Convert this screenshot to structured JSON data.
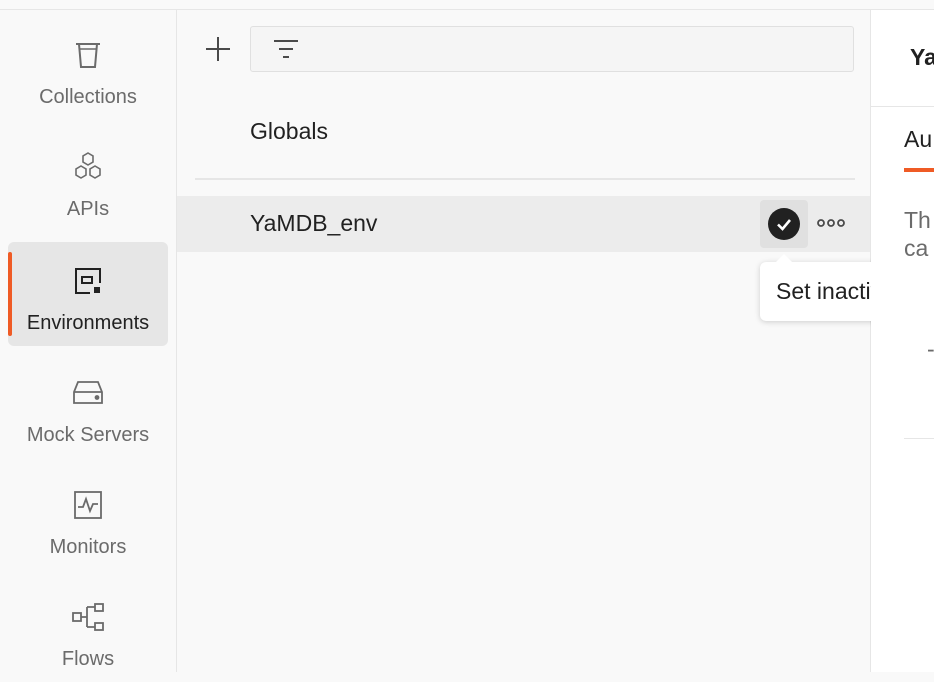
{
  "sidebar": {
    "items": [
      {
        "label": "Collections",
        "icon": "trash-can-icon"
      },
      {
        "label": "APIs",
        "icon": "hexagons-icon"
      },
      {
        "label": "Environments",
        "icon": "environment-icon",
        "active": true
      },
      {
        "label": "Mock Servers",
        "icon": "server-icon"
      },
      {
        "label": "Monitors",
        "icon": "monitor-pulse-icon"
      },
      {
        "label": "Flows",
        "icon": "flows-icon"
      }
    ]
  },
  "list": {
    "filter_placeholder": "",
    "globals_label": "Globals",
    "environments": [
      {
        "name": "YaMDB_env",
        "active": true
      }
    ]
  },
  "tooltip": {
    "text": "Set inactive"
  },
  "right_panel": {
    "title": "Ya",
    "tab": "Au",
    "text_line1": "Th",
    "text_line2": "ca",
    "mark": "-"
  },
  "colors": {
    "accent": "#ef5b25",
    "background": "#f9f9f9",
    "selected": "#e6e6e6"
  }
}
